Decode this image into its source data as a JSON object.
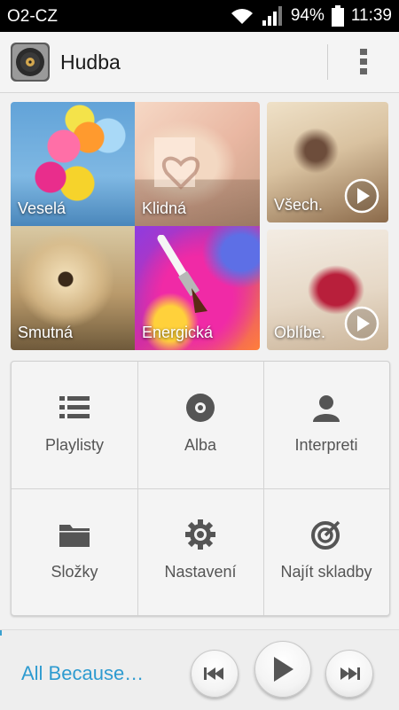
{
  "status_bar": {
    "carrier": "O2-CZ",
    "battery": "94%",
    "time": "11:39",
    "icons": [
      "wifi-icon",
      "signal-icon",
      "battery-icon"
    ]
  },
  "app_bar": {
    "title": "Hudba",
    "icon": "music-disc-icon",
    "menu_icon": "overflow-menu-icon"
  },
  "moods": [
    {
      "label": "Veselá"
    },
    {
      "label": "Klidná"
    },
    {
      "label": "Smutná"
    },
    {
      "label": "Energická"
    }
  ],
  "shortcuts": [
    {
      "label": "Všech.",
      "icon": "play-circle-icon"
    },
    {
      "label": "Oblíbe.",
      "icon": "play-circle-icon"
    }
  ],
  "grid": [
    {
      "label": "Playlisty",
      "icon": "list-icon"
    },
    {
      "label": "Alba",
      "icon": "disc-icon"
    },
    {
      "label": "Interpreti",
      "icon": "person-icon"
    },
    {
      "label": "Složky",
      "icon": "folder-icon"
    },
    {
      "label": "Nastavení",
      "icon": "gear-icon"
    },
    {
      "label": "Najít skladby",
      "icon": "target-icon"
    }
  ],
  "player": {
    "track": "All Because…",
    "accent_color": "#2e9bd0",
    "controls": [
      "previous-icon",
      "play-icon",
      "next-icon"
    ]
  }
}
